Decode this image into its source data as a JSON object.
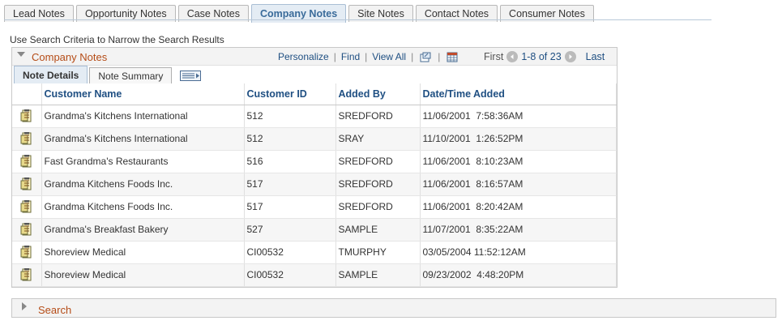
{
  "top_tabs": [
    {
      "label": "Lead Notes",
      "active": false
    },
    {
      "label": "Opportunity Notes",
      "active": false
    },
    {
      "label": "Case Notes",
      "active": false
    },
    {
      "label": "Company Notes",
      "active": true
    },
    {
      "label": "Site Notes",
      "active": false
    },
    {
      "label": "Contact Notes",
      "active": false
    },
    {
      "label": "Consumer Notes",
      "active": false
    }
  ],
  "instruction": "Use Search Criteria to Narrow the Search Results",
  "grid": {
    "title": "Company Notes",
    "personalize": "Personalize",
    "find": "Find",
    "view_all": "View All",
    "first": "First",
    "range": "1-8 of 23",
    "last": "Last",
    "subtabs": [
      "Note Details",
      "Note Summary"
    ],
    "columns": [
      "Customer Name",
      "Customer ID",
      "Added By",
      "Date/Time Added"
    ],
    "rows": [
      [
        "Grandma's Kitchens International",
        "512",
        "SREDFORD",
        "11/06/2001  7:58:36AM"
      ],
      [
        "Grandma's Kitchens International",
        "512",
        "SRAY",
        "11/10/2001  1:26:52PM"
      ],
      [
        "Fast Grandma's Restaurants",
        "516",
        "SREDFORD",
        "11/06/2001  8:10:23AM"
      ],
      [
        "Grandma Kitchens Foods Inc.",
        "517",
        "SREDFORD",
        "11/06/2001  8:16:57AM"
      ],
      [
        "Grandma Kitchens Foods Inc.",
        "517",
        "SREDFORD",
        "11/06/2001  8:20:42AM"
      ],
      [
        "Grandma's Breakfast Bakery",
        "527",
        "SAMPLE",
        "11/07/2001  8:35:22AM"
      ],
      [
        "Shoreview Medical",
        "CI00532",
        "TMURPHY",
        "03/05/2004 11:52:12AM"
      ],
      [
        "Shoreview Medical",
        "CI00532",
        "SAMPLE",
        "09/23/2002  4:48:20PM"
      ]
    ]
  },
  "search_section": "Search",
  "colors": {
    "accent": "#b54c17",
    "link": "#1f4f82",
    "active_tab": "#e4ecf4"
  }
}
